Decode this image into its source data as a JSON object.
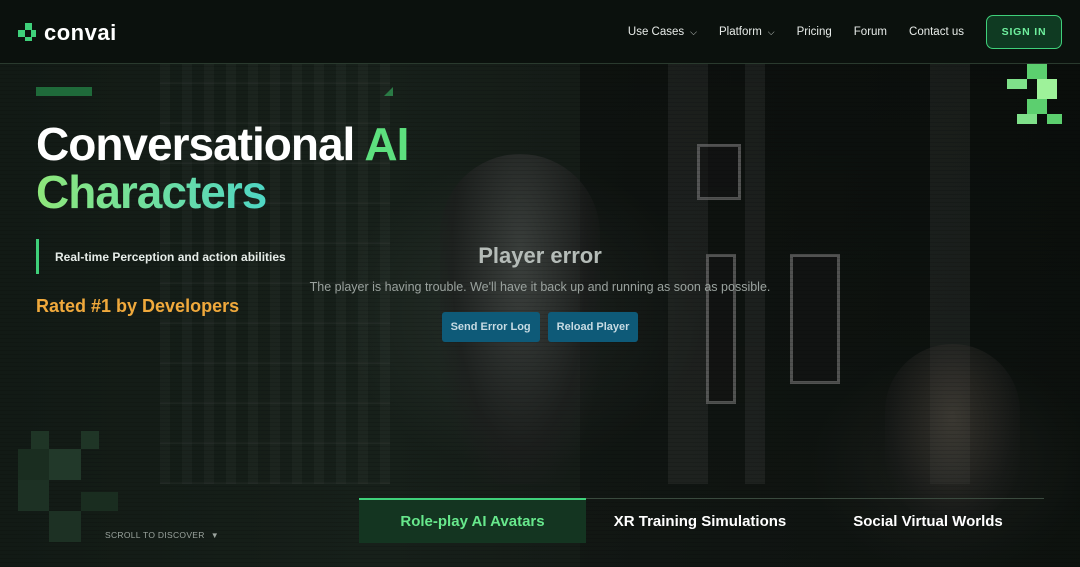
{
  "nav": {
    "brand": "convai",
    "links": [
      {
        "label": "Use Cases",
        "dropdown": true
      },
      {
        "label": "Platform",
        "dropdown": true
      },
      {
        "label": "Pricing",
        "dropdown": false
      },
      {
        "label": "Forum",
        "dropdown": false
      },
      {
        "label": "Contact us",
        "dropdown": false
      }
    ],
    "signin": "SIGN IN"
  },
  "hero": {
    "title_part1": "Conversational",
    "title_part2": "AI",
    "title_part3": "Characters",
    "tagline": "Real-time Perception and action abilities",
    "rated": "Rated #1 by Developers"
  },
  "player_error": {
    "title": "Player error",
    "message": "The player is having trouble. We'll have it back up and running as soon as possible.",
    "send_log": "Send Error Log",
    "reload": "Reload Player"
  },
  "scroll_hint": "SCROLL TO DISCOVER",
  "tabs": [
    {
      "label": "Role-play AI Avatars",
      "active": true
    },
    {
      "label": "XR Training Simulations",
      "active": false
    },
    {
      "label": "Social Virtual Worlds",
      "active": false
    }
  ],
  "colors": {
    "brand_green": "#3fd07a",
    "rated_orange": "#f0a93c",
    "player_button": "#0e5a78"
  }
}
